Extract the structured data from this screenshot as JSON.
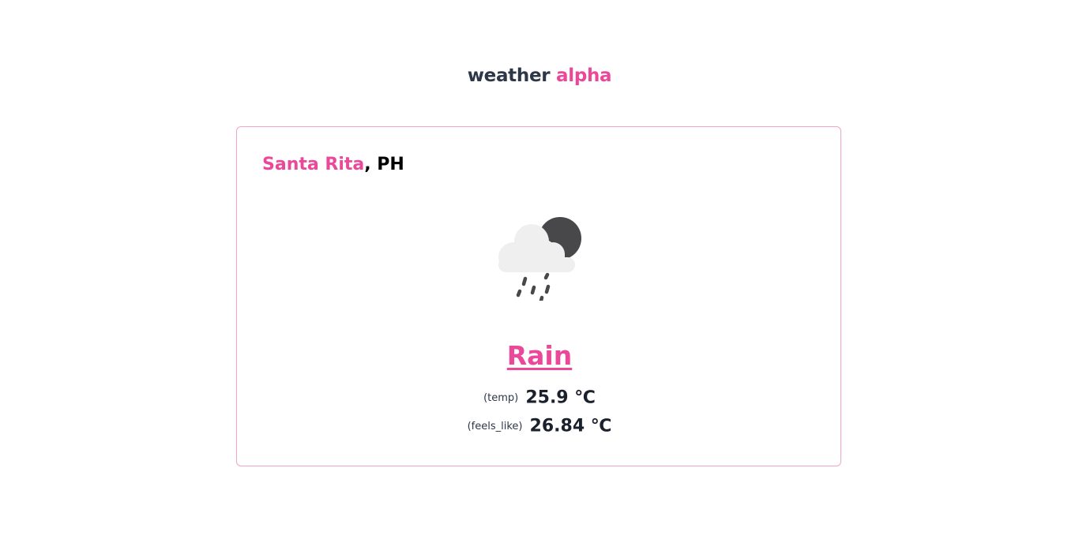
{
  "header": {
    "title_main": "weather",
    "title_accent": "alpha"
  },
  "location": {
    "city": "Santa Rita",
    "separator": ",",
    "country": "PH"
  },
  "weather": {
    "icon": "rain-cloud-night-icon",
    "condition": "Rain",
    "temp_label": "(temp)",
    "temp_value": "25.9 ℃",
    "feels_label": "(feels_like)",
    "feels_value": "26.84 ℃"
  },
  "colors": {
    "accent": "#ec4899",
    "text_dark": "#2d3748",
    "card_border": "#f4a4c8",
    "moon": "#48484a",
    "cloud": "#efefef"
  }
}
